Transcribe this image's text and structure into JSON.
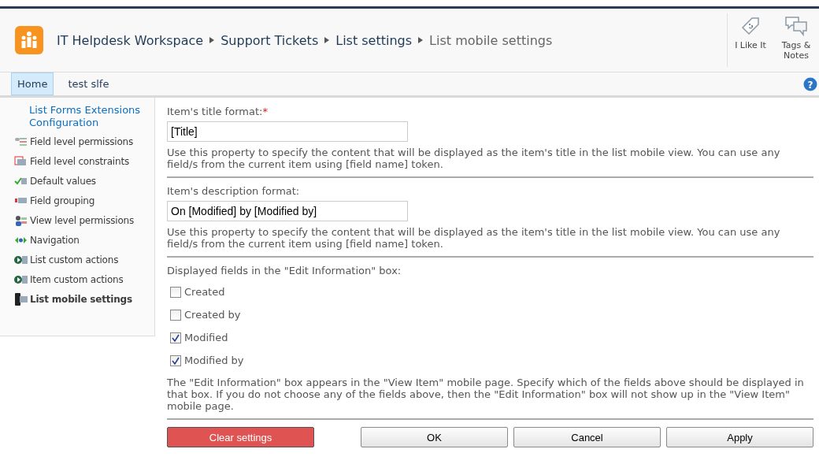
{
  "breadcrumb": [
    {
      "label": "IT Helpdesk Workspace",
      "selected": false
    },
    {
      "label": "Support Tickets",
      "selected": false
    },
    {
      "label": "List settings",
      "selected": false
    },
    {
      "label": "List mobile settings",
      "selected": true
    }
  ],
  "social": [
    {
      "kind": "like",
      "label": "I Like It"
    },
    {
      "kind": "tags",
      "label": "Tags & Notes"
    }
  ],
  "nav_tabs": [
    {
      "label": "Home",
      "selected": true
    },
    {
      "label": "test slfe",
      "selected": false
    }
  ],
  "help_glyph": "?",
  "sidebar": {
    "heading": "List Forms Extensions Configuration",
    "items": [
      {
        "kind": "permissions",
        "label": "Field level permissions",
        "selected": false
      },
      {
        "kind": "constraints",
        "label": "Field level constraints",
        "selected": false
      },
      {
        "kind": "defaults",
        "label": "Default values",
        "selected": false
      },
      {
        "kind": "grouping",
        "label": "Field grouping",
        "selected": false
      },
      {
        "kind": "view-permissions",
        "label": "View level permissions",
        "selected": false
      },
      {
        "kind": "navigation",
        "label": "Navigation",
        "selected": false
      },
      {
        "kind": "actions",
        "label": "List custom actions",
        "selected": false
      },
      {
        "kind": "actions",
        "label": "Item custom actions",
        "selected": false
      },
      {
        "kind": "mobile",
        "label": "List mobile settings",
        "selected": true
      }
    ]
  },
  "sections": [
    {
      "kind": "text",
      "label": "Item's title format:",
      "required_mark": "*",
      "value": "[Title]",
      "help": "Use this property to specify the content that will be displayed as the item's title in the list mobile view. You can use any field/s from the current item using [field name] token."
    },
    {
      "kind": "text",
      "label": "Item's description format:",
      "value": "On [Modified] by [Modified by]",
      "help": "Use this property to specify the content that will be displayed as the item's title in the list mobile view. You can use any field/s from the current item using [field name] token."
    },
    {
      "kind": "checks",
      "label": "Displayed fields in the \"Edit Information\" box:",
      "options": [
        {
          "label": "Created",
          "checked": false
        },
        {
          "label": "Created by",
          "checked": false
        },
        {
          "label": "Modified",
          "checked": true
        },
        {
          "label": "Modified by",
          "checked": true
        }
      ],
      "help": "The \"Edit Information\" box appears in the \"View Item\" mobile page. Specify which of the fields above should be displayed in that box. If you do not choose any of the fields above, then the \"Edit Information\" box will not show up in the \"View Item\" mobile page."
    }
  ],
  "buttons": [
    {
      "kind": "danger",
      "label": "Clear settings"
    },
    {
      "kind": "normal",
      "label": "OK"
    },
    {
      "kind": "normal",
      "label": "Cancel"
    },
    {
      "kind": "normal",
      "label": "Apply"
    }
  ]
}
